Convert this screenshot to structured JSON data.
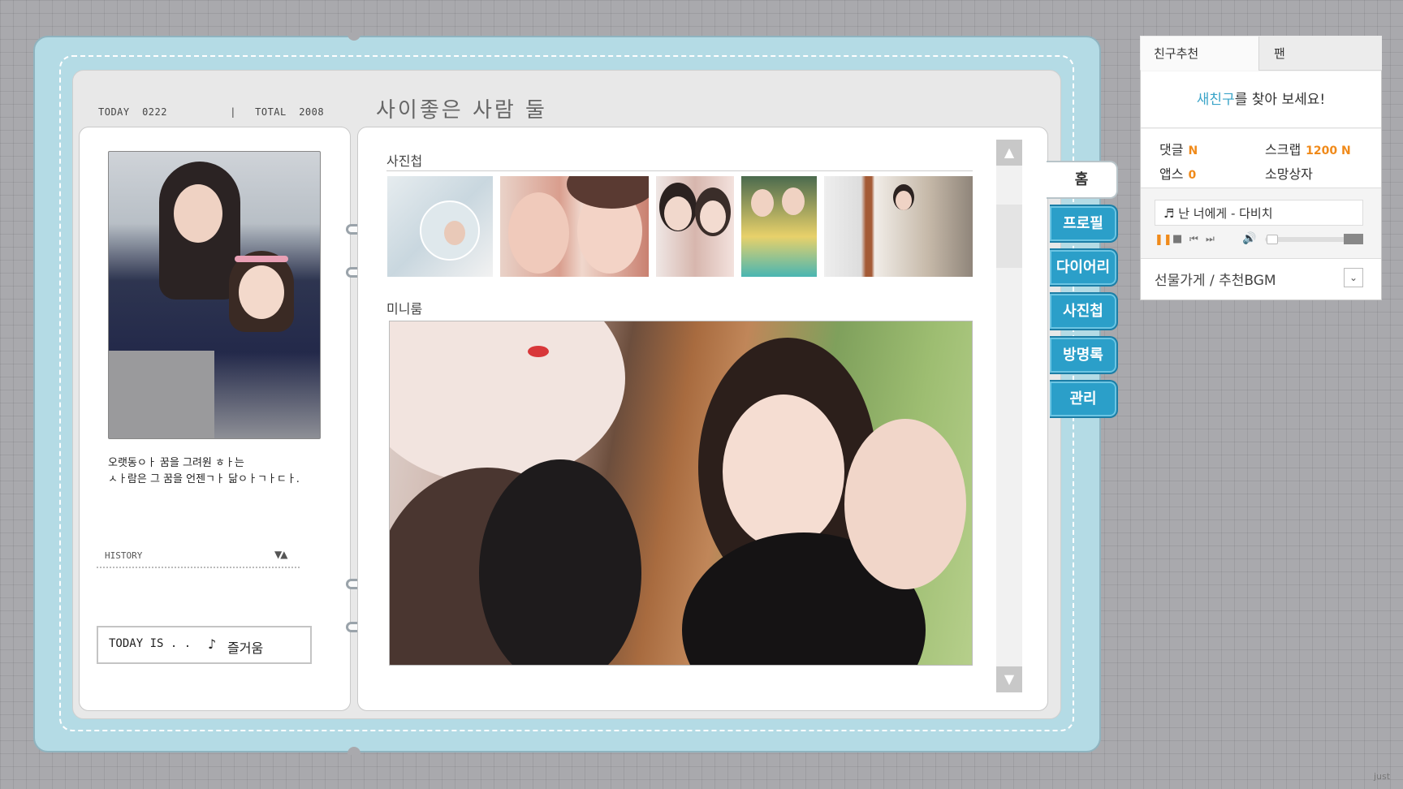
{
  "counter": {
    "text": "TODAY  0222          |   TOTAL  2008"
  },
  "page_title": "사이좋은 사람 둘",
  "profile": {
    "message": "오랫동ㅇㅏ 꿈을 그려원 ㅎㅏ는\nㅅㅏ람은 그 꿈을 언젠ㄱㅏ 닮ㅇㅏㄱㅏㄷㅏ.",
    "history_label": "HISTORY",
    "history_arrows": "▼▲",
    "today_label": "TODAY IS . .",
    "mood_icon": "♪",
    "mood_text": "즐거움"
  },
  "main": {
    "photos_title": "사진첩",
    "miniroom_title": "미니룸",
    "scroll_up": "▲",
    "scroll_down": "▼"
  },
  "tabs": [
    {
      "label": "홈",
      "active": true
    },
    {
      "label": "프로필",
      "active": false
    },
    {
      "label": "다이어리",
      "active": false
    },
    {
      "label": "사진첩",
      "active": false
    },
    {
      "label": "방명록",
      "active": false
    },
    {
      "label": "관리",
      "active": false
    }
  ],
  "widget": {
    "tab_friends": "친구추천",
    "tab_fan": "팬",
    "find_accent": "새친구",
    "find_rest": "를 찾아 보세요!",
    "stats": {
      "comments_label": "댓글",
      "comments_value": "N",
      "scrap_label": "스크랩",
      "scrap_value": "1200 N",
      "apps_label": "앱스",
      "apps_value": "0",
      "wishbox_label": "소망상자"
    },
    "bgm_title": "♬ 난 너에게 - 다비치",
    "controls": {
      "pause": "❚❚",
      "stop": "■",
      "prev": "⏮",
      "next": "⏭",
      "volume": "🔊"
    },
    "gift_label": "선물가게 / 추천BGM",
    "gift_dropdown": "⌄"
  },
  "watermark": "just",
  "colors": {
    "accent_blue": "#2b9fc9",
    "accent_orange": "#f08a1a",
    "frame": "#b4dbe5"
  }
}
